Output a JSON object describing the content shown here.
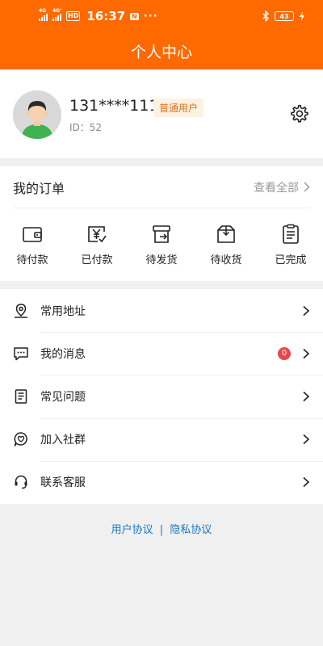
{
  "status_bar": {
    "signal1": "4G",
    "signal2": "4G⁺",
    "hd": "HD",
    "time": "16:37",
    "nfc": "N",
    "more": "···",
    "battery": "43"
  },
  "header": {
    "title": "个人中心"
  },
  "profile": {
    "username": "131****1111",
    "badge": "普通用户",
    "id_text": "ID：52"
  },
  "orders": {
    "title": "我的订单",
    "view_all": "查看全部",
    "items": [
      {
        "label": "待付款",
        "icon": "wallet-icon"
      },
      {
        "label": "已付款",
        "icon": "paid-yen-icon"
      },
      {
        "label": "待发货",
        "icon": "ship-box-icon"
      },
      {
        "label": "待收货",
        "icon": "receive-box-icon"
      },
      {
        "label": "已完成",
        "icon": "completed-doc-icon"
      }
    ]
  },
  "menu": [
    {
      "label": "常用地址",
      "icon": "location-icon"
    },
    {
      "label": "我的消息",
      "icon": "message-icon",
      "badge": "0"
    },
    {
      "label": "常见问题",
      "icon": "faq-doc-icon"
    },
    {
      "label": "加入社群",
      "icon": "community-icon"
    },
    {
      "label": "联系客服",
      "icon": "headset-icon"
    }
  ],
  "footer": {
    "user_agreement": "用户协议",
    "separator": "|",
    "privacy_policy": "隐私协议"
  },
  "colors": {
    "accent": "#ff6a00",
    "badge_bg": "#fdf1e2",
    "badge_text": "#d4731f",
    "notify_badge": "#e8474c",
    "link": "#1a78c2"
  }
}
